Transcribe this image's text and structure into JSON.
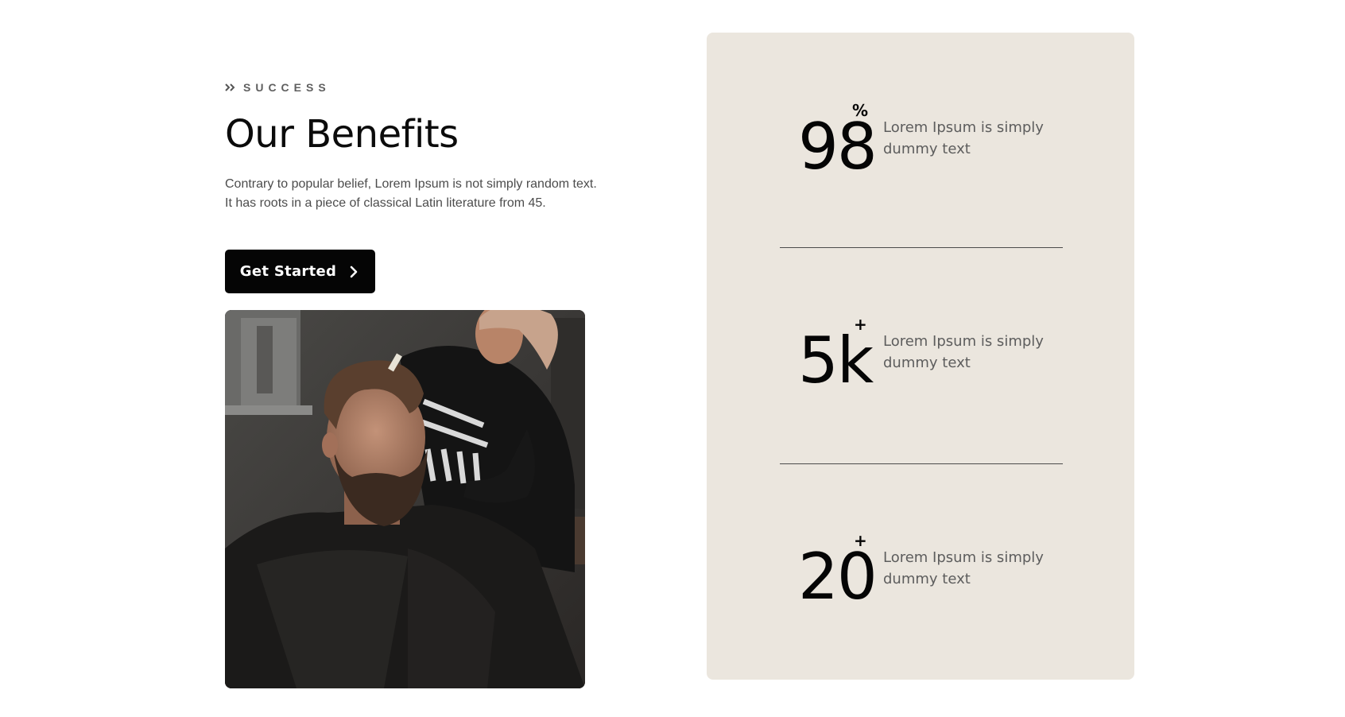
{
  "section": {
    "eyebrow_icon": "double-chevron-right-icon",
    "eyebrow": "SUCCESS",
    "title": "Our Benefits",
    "description": "Contrary to popular belief, Lorem Ipsum is not simply random text. It has roots in a piece of classical Latin literature from 45.",
    "cta_label": "Get Started",
    "cta_icon": "chevron-right-icon"
  },
  "stats": [
    {
      "value": "98",
      "suffix": "%",
      "text": "Lorem Ipsum is simply dummy text"
    },
    {
      "value": "5k",
      "suffix": "+",
      "text": "Lorem Ipsum is simply dummy text"
    },
    {
      "value": "20",
      "suffix": "+",
      "text": "Lorem Ipsum is simply dummy text"
    }
  ],
  "colors": {
    "panel_background": "#ebe6de",
    "button_background": "#050505",
    "button_text": "#ffffff",
    "heading": "#0b0b0b"
  }
}
